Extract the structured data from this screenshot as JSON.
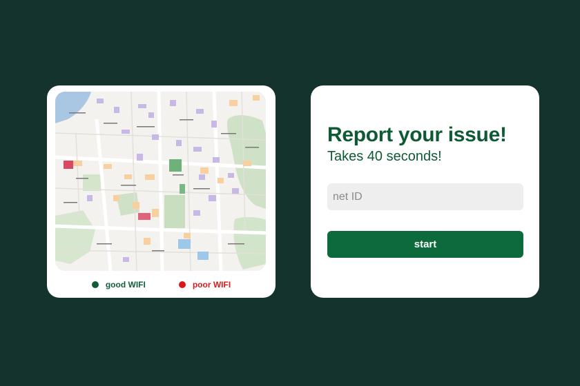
{
  "map_panel": {
    "legend": {
      "good": {
        "label": "good WIFI",
        "color": "#0f5e38"
      },
      "poor": {
        "label": "poor WIFI",
        "color": "#d61a1a"
      }
    }
  },
  "form_panel": {
    "title": "Report your issue!",
    "subtitle": "Takes 40 seconds!",
    "netid_placeholder": "net ID",
    "start_label": "start"
  },
  "colors": {
    "background": "#13332c",
    "brand_green": "#0d6a3c",
    "card": "#ffffff"
  }
}
